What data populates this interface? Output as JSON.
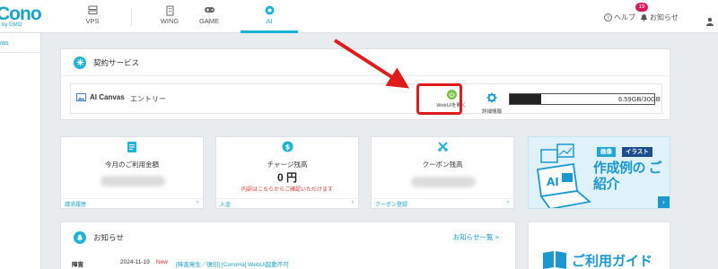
{
  "brand": {
    "logo_text": "ConoHa",
    "logo_sub": "by GMO"
  },
  "nav": {
    "tabs": [
      {
        "label": "VPS",
        "icon": "server-icon"
      },
      {
        "label": "WING",
        "icon": "building-icon"
      },
      {
        "label": "GAME",
        "icon": "gamepad-icon"
      },
      {
        "label": "AI",
        "icon": "ai-icon",
        "active": true
      }
    ],
    "help": "ヘルプ",
    "news": "お知らせ",
    "news_badge": "19"
  },
  "sidebar": {
    "item": "vas"
  },
  "contract": {
    "title": "契約サービス",
    "service_name": "AI Canvas",
    "plan": "エントリー",
    "webui_label": "WebUIを開く",
    "detail_label": "詳細情報",
    "storage_text": "6.59GB/30GB",
    "storage_used_fraction": 0.22
  },
  "stats": {
    "usage": {
      "title": "今月のご利用金額",
      "link": "請求履歴"
    },
    "charge": {
      "title": "チャージ残高",
      "value": "0 円",
      "note": "内訳はこちらからご確認いただけます",
      "link": "入金"
    },
    "coupon": {
      "title": "クーポン残高",
      "link": "クーポン登録"
    }
  },
  "banner_example": {
    "tag1": "画像",
    "tag2": "イラスト",
    "title": "作成例の ご紹介"
  },
  "news_panel": {
    "title": "お知らせ",
    "more": "お知らせ一覧 >",
    "row": {
      "category": "障害",
      "date": "2024-11-19",
      "new": "New",
      "text": "[障害発生／復旧] [ConoHa] WebUI起動不可"
    }
  },
  "banner_guide": {
    "title": "ご利用ガイド"
  },
  "colors": {
    "accent": "#19b5d8",
    "highlight": "#e01b1b",
    "alert": "#d6195c"
  }
}
